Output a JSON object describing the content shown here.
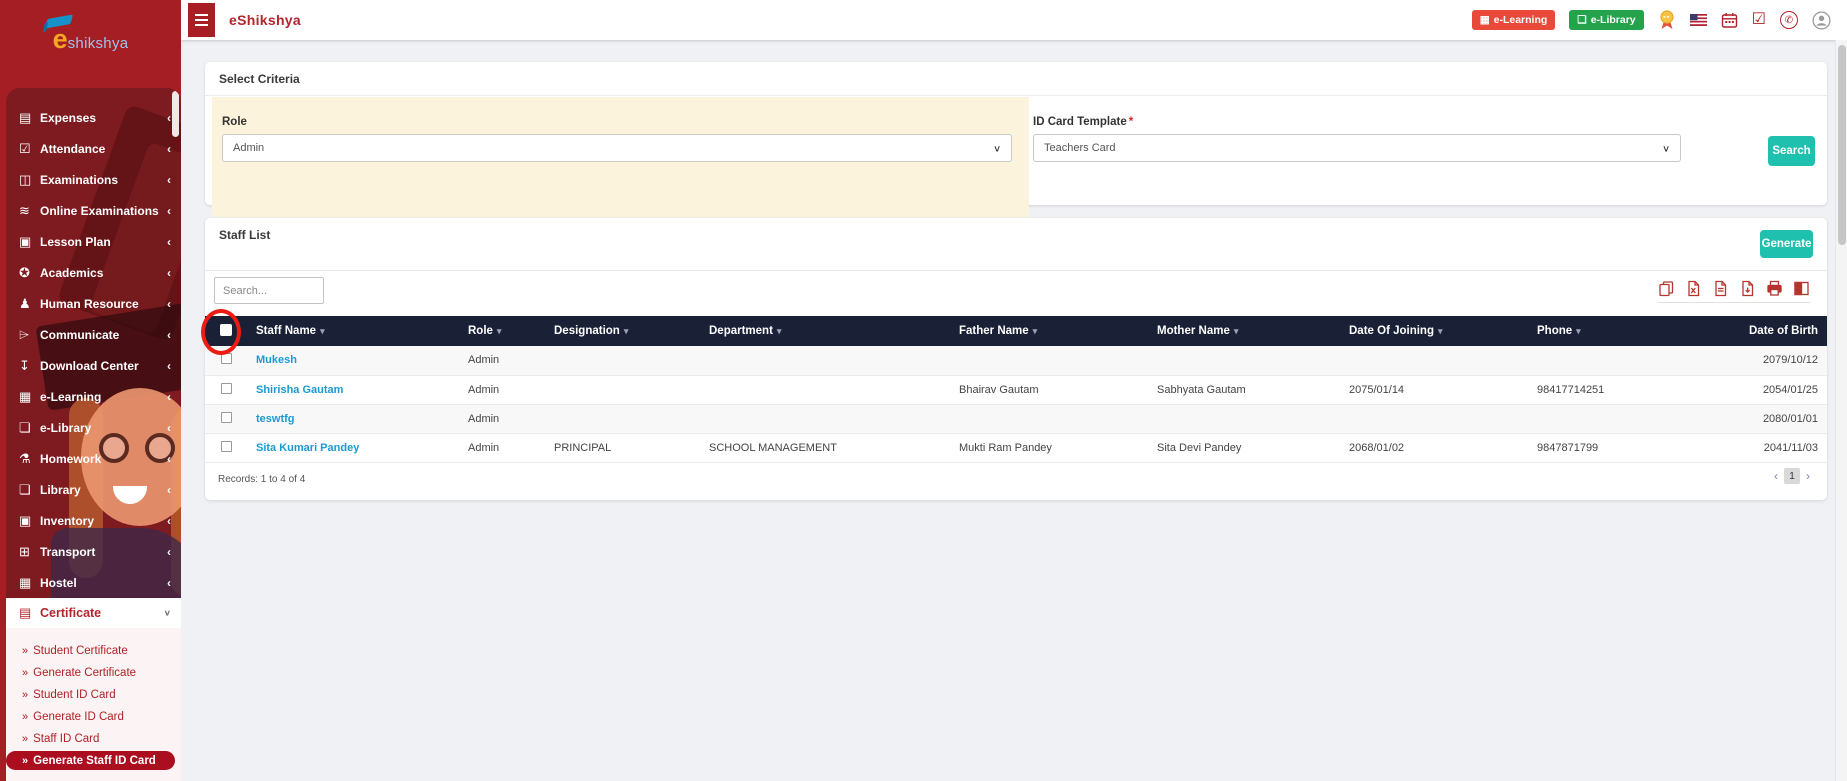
{
  "app": {
    "title": "eShikshya",
    "logo_e": "e",
    "logo_rest": "shikshya"
  },
  "icons": {
    "chevron_left": "‹",
    "chevron_down": "∨",
    "sort_arrow": "▾",
    "submenu_arrow": "»",
    "prev": "‹",
    "next": "›",
    "whatsapp_glyph": "✆",
    "check_glyph": "☑",
    "elearning_glyph": "▦",
    "elibrary_glyph": "❏"
  },
  "sidebar": {
    "items": [
      {
        "label": "Expenses",
        "icon": "expenses-icon",
        "glyph": "▤"
      },
      {
        "label": "Attendance",
        "icon": "attendance-icon",
        "glyph": "☑"
      },
      {
        "label": "Examinations",
        "icon": "examinations-icon",
        "glyph": "◫"
      },
      {
        "label": "Online Examinations",
        "icon": "online-examinations-icon",
        "glyph": "≋"
      },
      {
        "label": "Lesson Plan",
        "icon": "lesson-plan-icon",
        "glyph": "▣"
      },
      {
        "label": "Academics",
        "icon": "academics-icon",
        "glyph": "✪"
      },
      {
        "label": "Human Resource",
        "icon": "human-resource-icon",
        "glyph": "♟"
      },
      {
        "label": "Communicate",
        "icon": "communicate-icon",
        "glyph": "⌲"
      },
      {
        "label": "Download Center",
        "icon": "download-center-icon",
        "glyph": "↧"
      },
      {
        "label": "e-Learning",
        "icon": "e-learning-icon",
        "glyph": "▦"
      },
      {
        "label": "e-Library",
        "icon": "e-library-icon",
        "glyph": "❏"
      },
      {
        "label": "Homework",
        "icon": "homework-icon",
        "glyph": "⚗"
      },
      {
        "label": "Library",
        "icon": "library-icon",
        "glyph": "❏"
      },
      {
        "label": "Inventory",
        "icon": "inventory-icon",
        "glyph": "▣"
      },
      {
        "label": "Transport",
        "icon": "transport-icon",
        "glyph": "⊞"
      },
      {
        "label": "Hostel",
        "icon": "hostel-icon",
        "glyph": "▦"
      }
    ],
    "certificate": {
      "label": "Certificate",
      "glyph": "▤"
    },
    "submenu": [
      "Student Certificate",
      "Generate Certificate",
      "Student ID Card",
      "Generate ID Card",
      "Staff ID Card",
      "Generate Staff ID Card"
    ]
  },
  "topbar": {
    "elearning_button": "e-Learning",
    "elibrary_button": "e-Library"
  },
  "criteria": {
    "title": "Select Criteria",
    "role_label": "Role",
    "role_value": "Admin",
    "template_label": "ID Card Template",
    "required_mark": "*",
    "template_value": "Teachers Card",
    "search_button": "Search"
  },
  "staff_list": {
    "title": "Staff List",
    "generate_button": "Generate",
    "search_placeholder": "Search...",
    "export_tools": [
      "copy-icon",
      "excel-export-icon",
      "file-export-icon",
      "pdf-export-icon",
      "print-icon",
      "columns-icon"
    ],
    "columns": {
      "staff_name": "Staff Name",
      "role": "Role",
      "designation": "Designation",
      "department": "Department",
      "father_name": "Father Name",
      "mother_name": "Mother Name",
      "date_of_joining": "Date Of Joining",
      "phone": "Phone",
      "date_of_birth": "Date of Birth"
    },
    "rows": [
      {
        "name": "Mukesh",
        "role": "Admin",
        "designation": "",
        "department": "",
        "father_name": "",
        "mother_name": "",
        "date_of_joining": "",
        "phone": "",
        "date_of_birth": "2079/10/12"
      },
      {
        "name": "Shirisha Gautam",
        "role": "Admin",
        "designation": "",
        "department": "",
        "father_name": "Bhairav Gautam",
        "mother_name": "Sabhyata Gautam",
        "date_of_joining": "2075/01/14",
        "phone": "98417714251",
        "date_of_birth": "2054/01/25"
      },
      {
        "name": "teswtfg",
        "role": "Admin",
        "designation": "",
        "department": "",
        "father_name": "",
        "mother_name": "",
        "date_of_joining": "",
        "phone": "",
        "date_of_birth": "2080/01/01"
      },
      {
        "name": "Sita Kumari Pandey",
        "role": "Admin",
        "designation": "PRINCIPAL",
        "department": "SCHOOL MANAGEMENT",
        "father_name": "Mukti Ram Pandey",
        "mother_name": "Sita Devi Pandey",
        "date_of_joining": "2068/01/02",
        "phone": "9847871799",
        "date_of_birth": "2041/11/03"
      }
    ],
    "records_text": "Records: 1 to 4 of 4",
    "pagination": {
      "page": "1"
    }
  },
  "colors": {
    "sidebar_red": "#a51e24",
    "panel_maroon": "#7d1b20",
    "active_pill": "#ab0e1e",
    "header_navy": "#1a2137",
    "teal_button": "#1fc0ae",
    "link_blue": "#1b9ad2",
    "beige_panel": "#fcf3dc",
    "annotation_red": "#ec1c12"
  }
}
